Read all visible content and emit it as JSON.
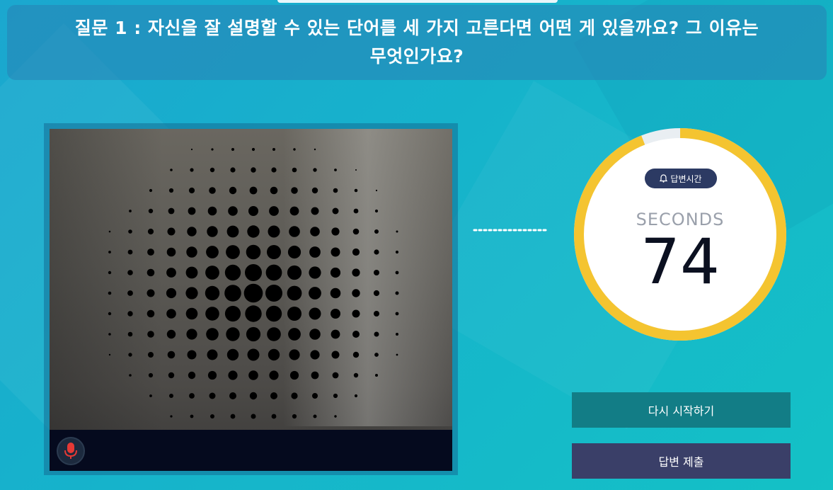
{
  "question": {
    "line1": "질문 1 : 자신을 잘 설명할 수 있는 단어를 세 가지 고른다면 어떤 게 있을까요? 그 이유는",
    "line2": "무엇인가요?"
  },
  "timer": {
    "badge_label": "답변시간",
    "unit_label": "SECONDS",
    "value": "74",
    "remaining_fraction": 0.94,
    "ring_color": "#f4c430",
    "track_color": "#e9eef2"
  },
  "buttons": {
    "restart_label": "다시 시작하기",
    "submit_label": "답변 제출"
  },
  "icons": {
    "microphone": "microphone-icon",
    "bell": "bell-icon"
  },
  "colors": {
    "background": "#16b3cb",
    "question_bar": "#2882b4",
    "restart_button": "#127d86",
    "submit_button": "#3a3f68",
    "badge": "#2c3a63",
    "mic": "#e53935"
  }
}
